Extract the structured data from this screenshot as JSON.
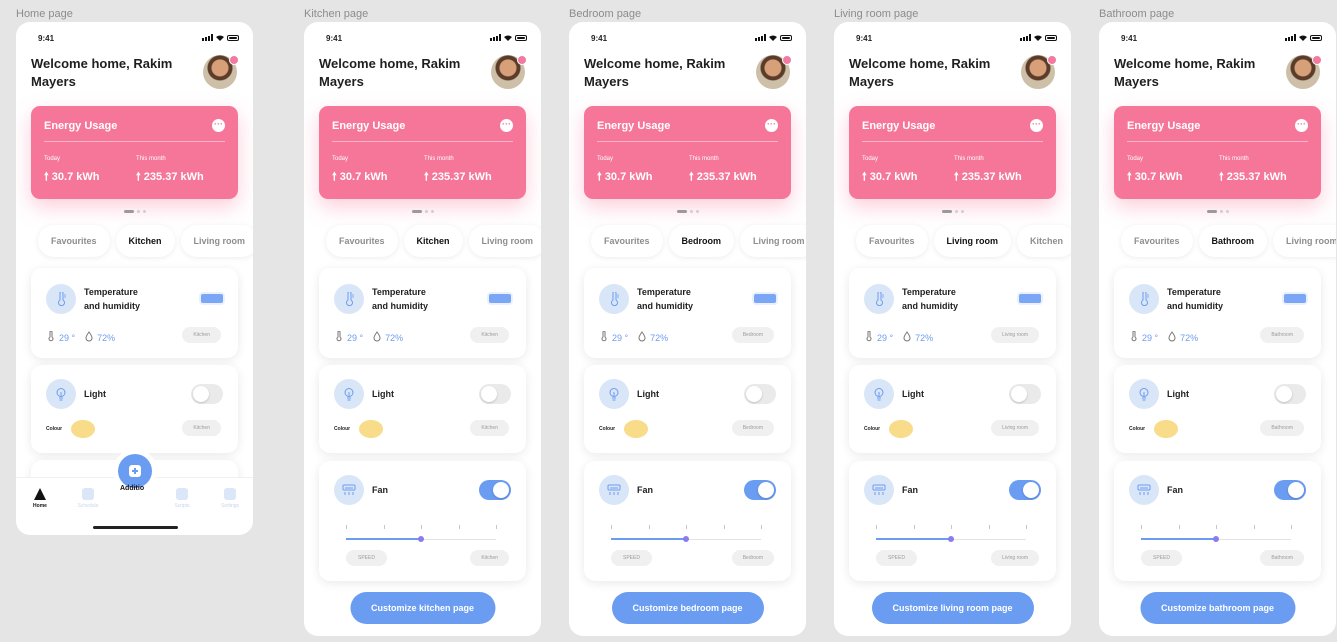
{
  "status_time": "9:41",
  "welcome": "Welcome home, Rakim Mayers",
  "energy": {
    "title": "Energy Usage",
    "more": "···",
    "today_label": "Today",
    "today_value": "30.7 kWh",
    "month_label": "This month",
    "month_value": "235.37 kWh"
  },
  "cards": {
    "temp_title": "Temperature and humidity",
    "temp_value": "29 °",
    "humidity_value": "72%",
    "light_title": "Light",
    "colour_label": "Colour",
    "fan_title": "Fan",
    "speed_label": "SPEED"
  },
  "nav": {
    "home": "Home",
    "schedule": "Schedule",
    "fab_label": "Additio",
    "scripts": "Scripts",
    "settings": "Settings"
  },
  "screens": [
    {
      "label": "Home page",
      "tabs": [
        "Favourites",
        "Kitchen",
        "Living room"
      ],
      "active_tab": 1,
      "room": "Kitchen",
      "light_on": false
    },
    {
      "label": "Kitchen page",
      "tabs": [
        "Favourites",
        "Kitchen",
        "Living room"
      ],
      "active_tab": 1,
      "room": "Kitchen",
      "light_on": false,
      "fan_on": true,
      "fan_speed": 0.5,
      "cta": "Customize kitchen page"
    },
    {
      "label": "Bedroom page",
      "tabs": [
        "Favourites",
        "Bedroom",
        "Living room"
      ],
      "active_tab": 1,
      "room": "Bedroom",
      "light_on": false,
      "fan_on": true,
      "fan_speed": 0.5,
      "cta": "Customize bedroom page"
    },
    {
      "label": "Living room page",
      "tabs": [
        "Favourites",
        "Living room",
        "Kitchen"
      ],
      "active_tab": 1,
      "room": "Living room",
      "light_on": false,
      "fan_on": true,
      "fan_speed": 0.5,
      "cta": "Customize living room page"
    },
    {
      "label": "Bathroom page",
      "tabs": [
        "Favourites",
        "Bathroom",
        "Living room"
      ],
      "active_tab": 1,
      "room": "Bathroom",
      "light_on": false,
      "fan_on": true,
      "fan_speed": 0.5,
      "cta": "Customize bathroom page"
    }
  ],
  "colors": {
    "accent_pink": "#f6769a",
    "accent_blue": "#6a9cf2",
    "swatch_yellow": "#f8dc8a"
  }
}
